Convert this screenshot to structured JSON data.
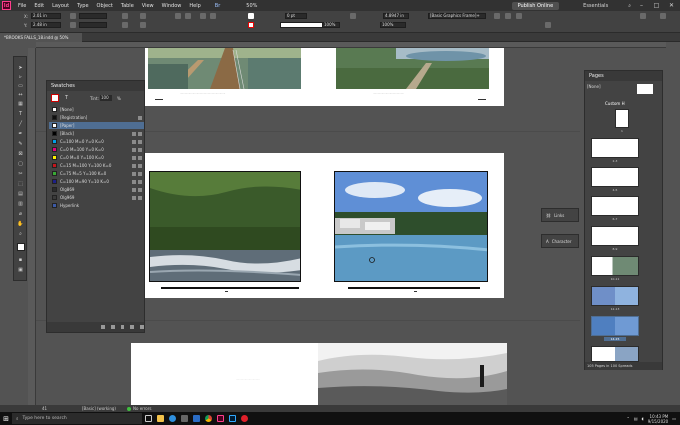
{
  "menubar": {
    "app_badge": "Id",
    "items": [
      "File",
      "Edit",
      "Layout",
      "Type",
      "Object",
      "Table",
      "View",
      "Window",
      "Help"
    ],
    "zoom": "50%",
    "publish": "Publish Online",
    "workspace": "Essentials"
  },
  "control": {
    "x": "2.01 in",
    "y": "2.48 in",
    "w": "4.8947 in",
    "pt": "0 pt",
    "pct1": "100%",
    "pct2": "100%",
    "frame_style": "[Basic Graphics Frame]+"
  },
  "document_tab": "*BROOKS FALLS_18.indd @ 50%",
  "swatches": {
    "title": "Swatches",
    "tint_label": "Tint:",
    "tint_value": "100",
    "tint_unit": "%",
    "items": [
      {
        "name": "[None]",
        "color": "#ffffff"
      },
      {
        "name": "[Registration]",
        "color": "#111111"
      },
      {
        "name": "[Paper]",
        "color": "#ffffff"
      },
      {
        "name": "[Black]",
        "color": "#000000"
      },
      {
        "name": "C=100 M=0 Y=0 K=0",
        "color": "#00a0e9"
      },
      {
        "name": "C=0 M=100 Y=0 K=0",
        "color": "#e4007f"
      },
      {
        "name": "C=0 M=0 Y=100 K=0",
        "color": "#fff100"
      },
      {
        "name": "C=15 M=100 Y=100 K=0",
        "color": "#c5161d"
      },
      {
        "name": "C=75 M=5 Y=100 K=0",
        "color": "#39a935"
      },
      {
        "name": "C=100 M=90 Y=10 K=0",
        "color": "#1d2088"
      },
      {
        "name": "Olg869",
        "color": "#2b2b2b"
      },
      {
        "name": "Olg969",
        "color": "#3a3a3a"
      },
      {
        "name": "Hyperlink",
        "color": "#3c5aa6"
      }
    ]
  },
  "side_panels": {
    "links": "Links",
    "character": "Character"
  },
  "pages": {
    "title": "Pages",
    "none": "[None]",
    "master": "Custom H",
    "labels": [
      "1",
      "2-3",
      "4-5",
      "6-7",
      "8-9",
      "10-11",
      "12-13",
      "14-15",
      "16-17"
    ],
    "footer": "105 Pages in 100 Spreads"
  },
  "status": {
    "page": "41",
    "state": "[Basic] (working)",
    "errors": "No errors"
  },
  "taskbar": {
    "search": "Type here to search",
    "time": "10:43 PM",
    "date": "9/15/2020"
  },
  "colors": {
    "accent": "#4f6e93",
    "app_pink": "#ff3d8b"
  }
}
